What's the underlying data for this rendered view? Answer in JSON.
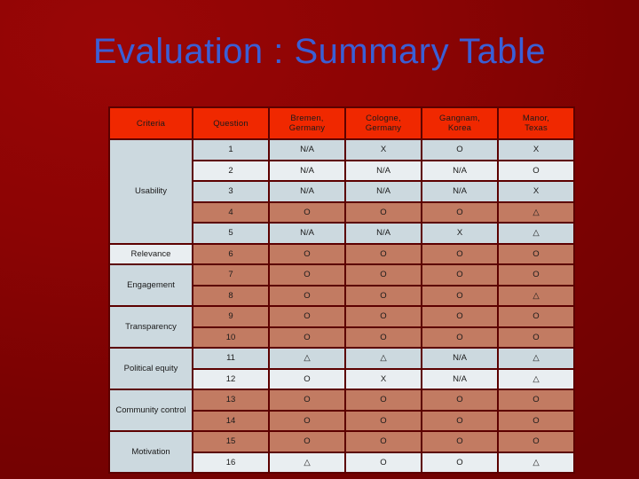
{
  "slide": {
    "title": "Evaluation : Summary Table",
    "title_color": "#3a5fd6",
    "background_color": "#8c0404"
  },
  "table": {
    "header_bg": "#f02800",
    "header_text_color": "#ffffff",
    "border_color": "#5c0000",
    "tint_blue": "#ccd9df",
    "tint_white": "#e9eef1",
    "tint_salmon": "#c27b62",
    "columns": [
      "Criteria",
      "Question",
      "Bremen,\nGermany",
      "Cologne,\nGermany",
      "Gangnam,\nKorea",
      "Manor,\nTexas"
    ],
    "columns_display": [
      {
        "line1": "Criteria",
        "line2": ""
      },
      {
        "line1": "Question",
        "line2": ""
      },
      {
        "line1": "Bremen,",
        "line2": "Germany"
      },
      {
        "line1": "Cologne,",
        "line2": "Germany"
      },
      {
        "line1": "Gangnam,",
        "line2": "Korea"
      },
      {
        "line1": "Manor,",
        "line2": "Texas"
      }
    ],
    "criteria_groups": [
      {
        "label": "Usability",
        "rowspan": 5,
        "tint": "t-blue"
      },
      {
        "label": "Relevance",
        "rowspan": 1,
        "tint": "t-white"
      },
      {
        "label": "Engagement",
        "rowspan": 2,
        "tint": "t-blue"
      },
      {
        "label": "Transparency",
        "rowspan": 2,
        "tint": "t-blue"
      },
      {
        "label": "Political equity",
        "rowspan": 2,
        "tint": "t-blue"
      },
      {
        "label": "Community control",
        "rowspan": 2,
        "tint": "t-blue"
      },
      {
        "label": "Motivation",
        "rowspan": 2,
        "tint": "t-blue"
      }
    ],
    "rows": [
      {
        "question": "1",
        "tint": "t-blue",
        "bremen": "N/A",
        "cologne": "X",
        "gangnam": "O",
        "manor": "X"
      },
      {
        "question": "2",
        "tint": "t-white",
        "bremen": "N/A",
        "cologne": "N/A",
        "gangnam": "N/A",
        "manor": "O"
      },
      {
        "question": "3",
        "tint": "t-blue",
        "bremen": "N/A",
        "cologne": "N/A",
        "gangnam": "N/A",
        "manor": "X"
      },
      {
        "question": "4",
        "tint": "t-salm",
        "bremen": "O",
        "cologne": "O",
        "gangnam": "O",
        "manor": "△"
      },
      {
        "question": "5",
        "tint": "t-blue",
        "bremen": "N/A",
        "cologne": "N/A",
        "gangnam": "X",
        "manor": "△"
      },
      {
        "question": "6",
        "tint": "t-salm",
        "bremen": "O",
        "cologne": "O",
        "gangnam": "O",
        "manor": "O"
      },
      {
        "question": "7",
        "tint": "t-salm",
        "bremen": "O",
        "cologne": "O",
        "gangnam": "O",
        "manor": "O"
      },
      {
        "question": "8",
        "tint": "t-salm",
        "bremen": "O",
        "cologne": "O",
        "gangnam": "O",
        "manor": "△"
      },
      {
        "question": "9",
        "tint": "t-salm",
        "bremen": "O",
        "cologne": "O",
        "gangnam": "O",
        "manor": "O"
      },
      {
        "question": "10",
        "tint": "t-salm",
        "bremen": "O",
        "cologne": "O",
        "gangnam": "O",
        "manor": "O"
      },
      {
        "question": "11",
        "tint": "t-blue",
        "bremen": "△",
        "cologne": "△",
        "gangnam": "N/A",
        "manor": "△"
      },
      {
        "question": "12",
        "tint": "t-white",
        "bremen": "O",
        "cologne": "X",
        "gangnam": "N/A",
        "manor": "△"
      },
      {
        "question": "13",
        "tint": "t-salm",
        "bremen": "O",
        "cologne": "O",
        "gangnam": "O",
        "manor": "O"
      },
      {
        "question": "14",
        "tint": "t-salm",
        "bremen": "O",
        "cologne": "O",
        "gangnam": "O",
        "manor": "O"
      },
      {
        "question": "15",
        "tint": "t-salm",
        "bremen": "O",
        "cologne": "O",
        "gangnam": "O",
        "manor": "O"
      },
      {
        "question": "16",
        "tint": "t-white",
        "bremen": "△",
        "cologne": "O",
        "gangnam": "O",
        "manor": "△"
      }
    ]
  }
}
